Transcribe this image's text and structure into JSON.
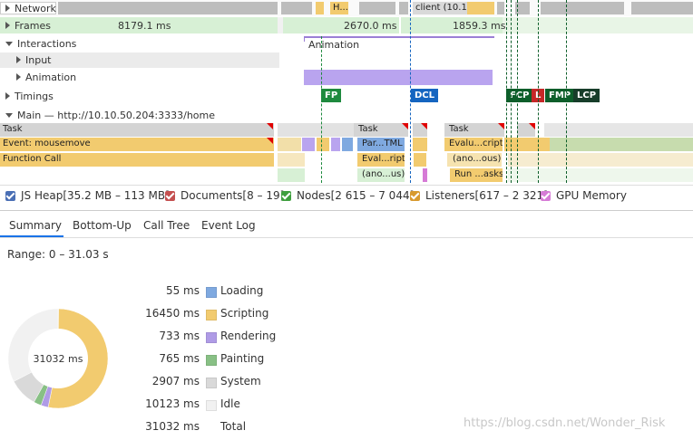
{
  "tracks": {
    "network": "Network",
    "frames": "Frames",
    "frame_times": [
      "8179.1 ms",
      "2670.0 ms",
      "1859.3 ms"
    ],
    "interactions": "Interactions",
    "input": "Input",
    "animation": "Animation",
    "animation_label": "Animation",
    "timings": "Timings",
    "main": "Main — http://10.10.50.204:3333/home",
    "network_snips": [
      "H...",
      "client (10.10"
    ]
  },
  "timing_markers": [
    {
      "label": "FP",
      "color": "#1e8a3e"
    },
    {
      "label": "DCL",
      "color": "#1565c0"
    },
    {
      "label": "FCP",
      "color": "#0d5e2a"
    },
    {
      "label": "L",
      "color": "#c62828"
    },
    {
      "label": "FMP",
      "color": "#0d5e2a"
    },
    {
      "label": "LCP",
      "color": "#173d2a"
    }
  ],
  "flame": {
    "task": "Task",
    "event": "Event: mousemove",
    "function_call": "Function Call",
    "parse_html": "Par...TML",
    "evaluate_script_1": "Eval...ript",
    "evaluate_script_2": "Evalu...cript",
    "anonymous_1": "(ano...us)",
    "anonymous_2": "(ano...ous)",
    "run_tasks": "Run ...asks"
  },
  "legend": [
    {
      "label": "JS Heap[35.2 MB – 113 MB]",
      "color": "#4a6fb5"
    },
    {
      "label": "Documents[8 – 19]",
      "color": "#c44f4f"
    },
    {
      "label": "Nodes[2 615 – 7 044]",
      "color": "#3f9f3f"
    },
    {
      "label": "Listeners[617 – 2 321]",
      "color": "#d89a2f"
    },
    {
      "label": "GPU Memory",
      "color": "#d67bd6"
    }
  ],
  "tabs": [
    "Summary",
    "Bottom-Up",
    "Call Tree",
    "Event Log"
  ],
  "range": "Range: 0 – 31.03 s",
  "donut_center": "31032 ms",
  "summary": [
    {
      "value": "55 ms",
      "name": "Loading",
      "color": "#7fa9e0",
      "fraction": 0.0018
    },
    {
      "value": "16450 ms",
      "name": "Scripting",
      "color": "#f2cb6f",
      "fraction": 0.5301
    },
    {
      "value": "733 ms",
      "name": "Rendering",
      "color": "#af9be6",
      "fraction": 0.0236
    },
    {
      "value": "765 ms",
      "name": "Painting",
      "color": "#88c085",
      "fraction": 0.0247
    },
    {
      "value": "2907 ms",
      "name": "System",
      "color": "#d9d9d9",
      "fraction": 0.0937
    },
    {
      "value": "10123 ms",
      "name": "Idle",
      "color": "#f1f1f1",
      "fraction": 0.3262
    },
    {
      "value": "31032 ms",
      "name": "Total",
      "color": "",
      "fraction": 1
    }
  ],
  "watermark": "https://blog.csdn.net/Wonder_Risk"
}
